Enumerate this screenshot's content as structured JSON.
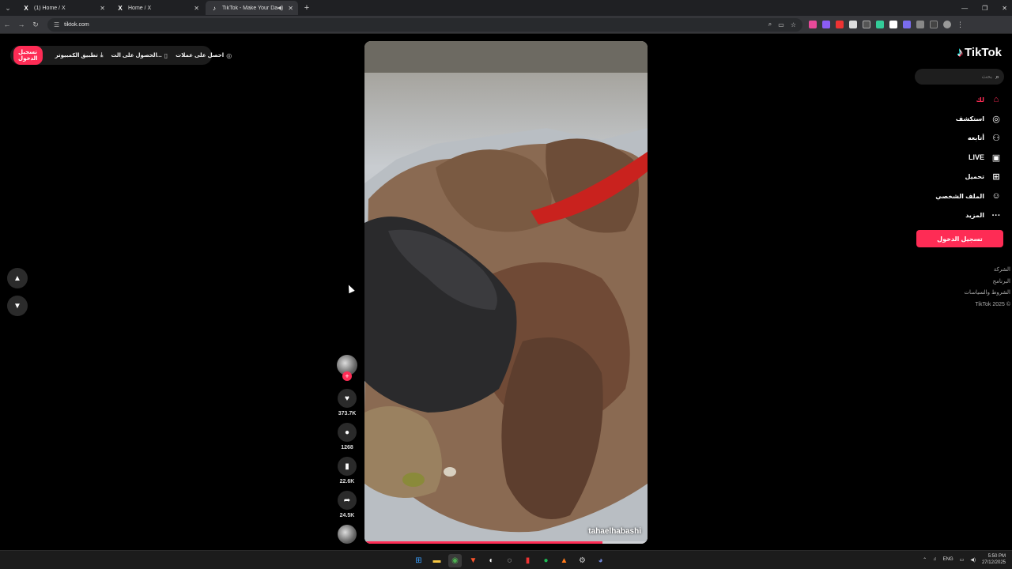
{
  "browser": {
    "tabs": [
      {
        "icon": "X",
        "title": "(1) Home / X",
        "active": false
      },
      {
        "icon": "X",
        "title": "Home / X",
        "active": false
      },
      {
        "icon": "♪",
        "title": "TikTok - Make Your Day",
        "active": true
      }
    ],
    "url": "tiktok.com"
  },
  "promo": {
    "login": "تسجيل الدخول",
    "desktop_app": "تطبيق الكمبيوتر",
    "get_app": "الحصول على الت...",
    "get_coins": "احصل على عملات"
  },
  "video": {
    "author": "tahaelhabashi",
    "progress": 0.84
  },
  "actions": {
    "likes": "373.7K",
    "comments": "1268",
    "saves": "22.6K",
    "shares": "24.5K"
  },
  "sidebar": {
    "logo": "TikTok",
    "search_placeholder": "بحث",
    "menu": [
      {
        "label": "لك",
        "icon": "home-icon",
        "active": true
      },
      {
        "label": "استكشف",
        "icon": "compass-icon",
        "active": false
      },
      {
        "label": "أتابعه",
        "icon": "user-follow-icon",
        "active": false
      },
      {
        "label": "LIVE",
        "icon": "live-icon",
        "active": false
      },
      {
        "label": "تحميل",
        "icon": "upload-icon",
        "active": false
      },
      {
        "label": "الملف الشخصي",
        "icon": "profile-icon",
        "active": false
      },
      {
        "label": "المزيد",
        "icon": "more-icon",
        "active": false
      }
    ],
    "login_button": "تسجيل الدخول",
    "footer": [
      "الشركة",
      "البرنامج",
      "الشروط والسياسات",
      "TikTok 2025 ©"
    ]
  },
  "taskbar": {
    "lang": "ENG",
    "time": "5:50 PM",
    "date": "27/12/2025"
  },
  "colors": {
    "accent": "#fe2c55",
    "background": "#000000"
  }
}
